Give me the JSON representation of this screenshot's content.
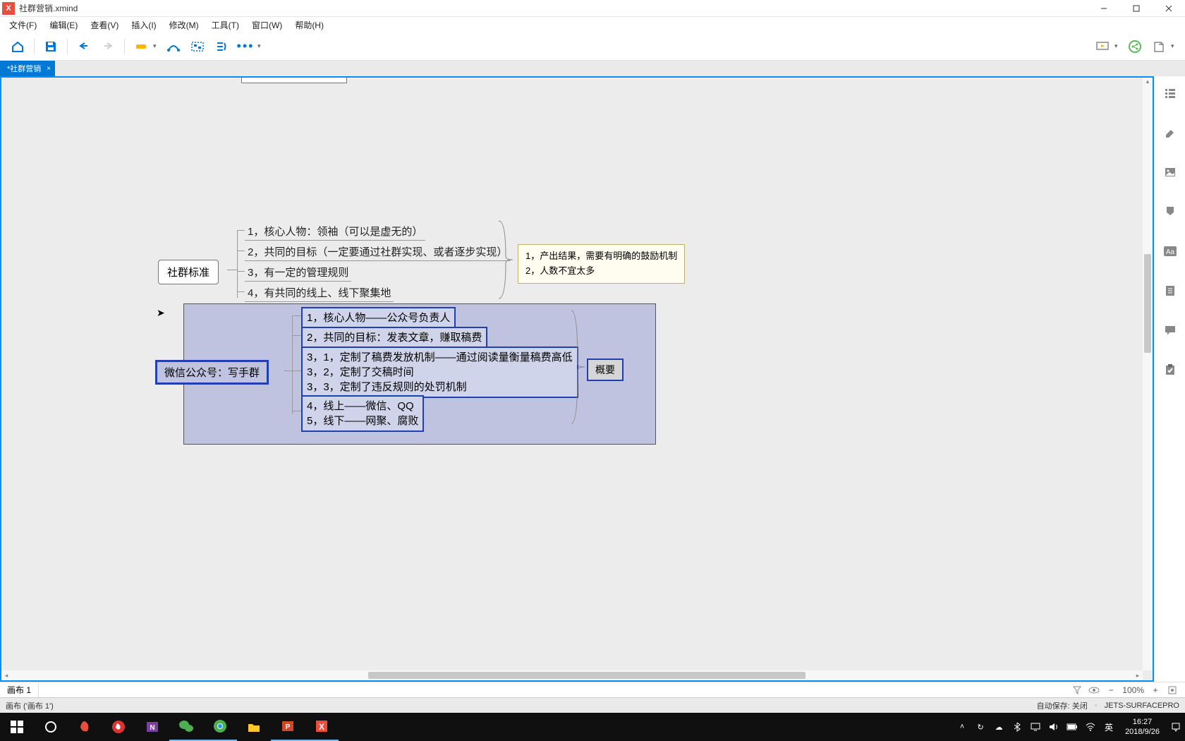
{
  "window": {
    "title": "社群营销.xmind"
  },
  "menu": {
    "file": "文件(F)",
    "edit": "编辑(E)",
    "view": "查看(V)",
    "insert": "插入(I)",
    "modify": "修改(M)",
    "tools": "工具(T)",
    "window": "窗口(W)",
    "help": "帮助(H)"
  },
  "tab": {
    "label": "*社群营销",
    "close": "×"
  },
  "mindmap": {
    "node1": "社群标准",
    "n1_items": [
      "1，核心人物：领袖（可以是虚无的）",
      "2，共同的目标（一定要通过社群实现、或者逐步实现）",
      "3，有一定的管理规则",
      "4，有共同的线上、线下聚集地"
    ],
    "n1_summary": [
      "1，产出结果，需要有明确的鼓励机制",
      "2，人数不宜太多"
    ],
    "node2": "微信公众号：写手群",
    "n2_a": "1，核心人物——公众号负责人",
    "n2_b": "2，共同的目标：发表文章，赚取稿费",
    "n2_c": [
      "3，1，定制了稿费发放机制——通过阅读量衡量稿费高低",
      "3，2，定制了交稿时间",
      "3，3，定制了违反规则的处罚机制"
    ],
    "n2_d": [
      "4，线上——微信、QQ",
      "5，线下——网聚、腐败"
    ],
    "n2_summary": "概要"
  },
  "sheet": {
    "name": "画布 1"
  },
  "zoom": {
    "value": "100%"
  },
  "status": {
    "left": "画布 ('画布 1')",
    "autosave": "自动保存: 关闭",
    "host": "JETS-SURFACEPRO"
  },
  "tray": {
    "ime": "英",
    "time": "16:27",
    "date": "2018/9/26"
  }
}
